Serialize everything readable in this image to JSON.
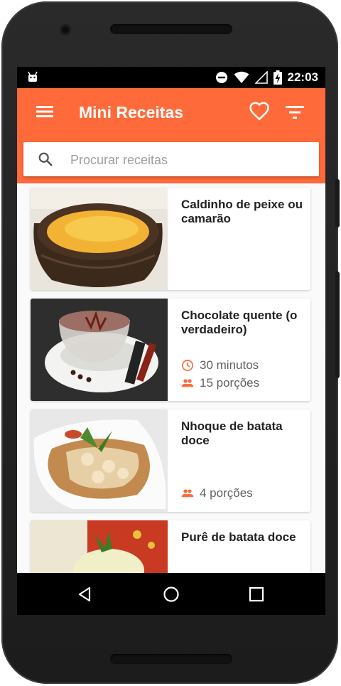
{
  "status_bar": {
    "time": "22:03",
    "left_icon": "android-notification-icon",
    "icons": [
      "do-not-disturb-icon",
      "wifi-icon",
      "signal-icon",
      "battery-charging-icon"
    ]
  },
  "app_bar": {
    "title": "Mini Receitas",
    "menu_icon": "menu-icon",
    "favorites_icon": "heart-icon",
    "filter_icon": "filter-icon",
    "accent_color": "#fe6a3a"
  },
  "search": {
    "placeholder": "Procurar receitas",
    "value": ""
  },
  "recipes": [
    {
      "title": "Caldinho de peixe ou camarão"
    },
    {
      "title": "Chocolate quente (o verdadeiro)",
      "time": "30 minutos",
      "servings": "15 porções"
    },
    {
      "title": "Nhoque de batata doce",
      "servings": "4 porções"
    },
    {
      "title": "Purê de batata doce"
    }
  ],
  "nav_bar": {
    "buttons": [
      "back-icon",
      "home-icon",
      "recents-icon"
    ]
  }
}
